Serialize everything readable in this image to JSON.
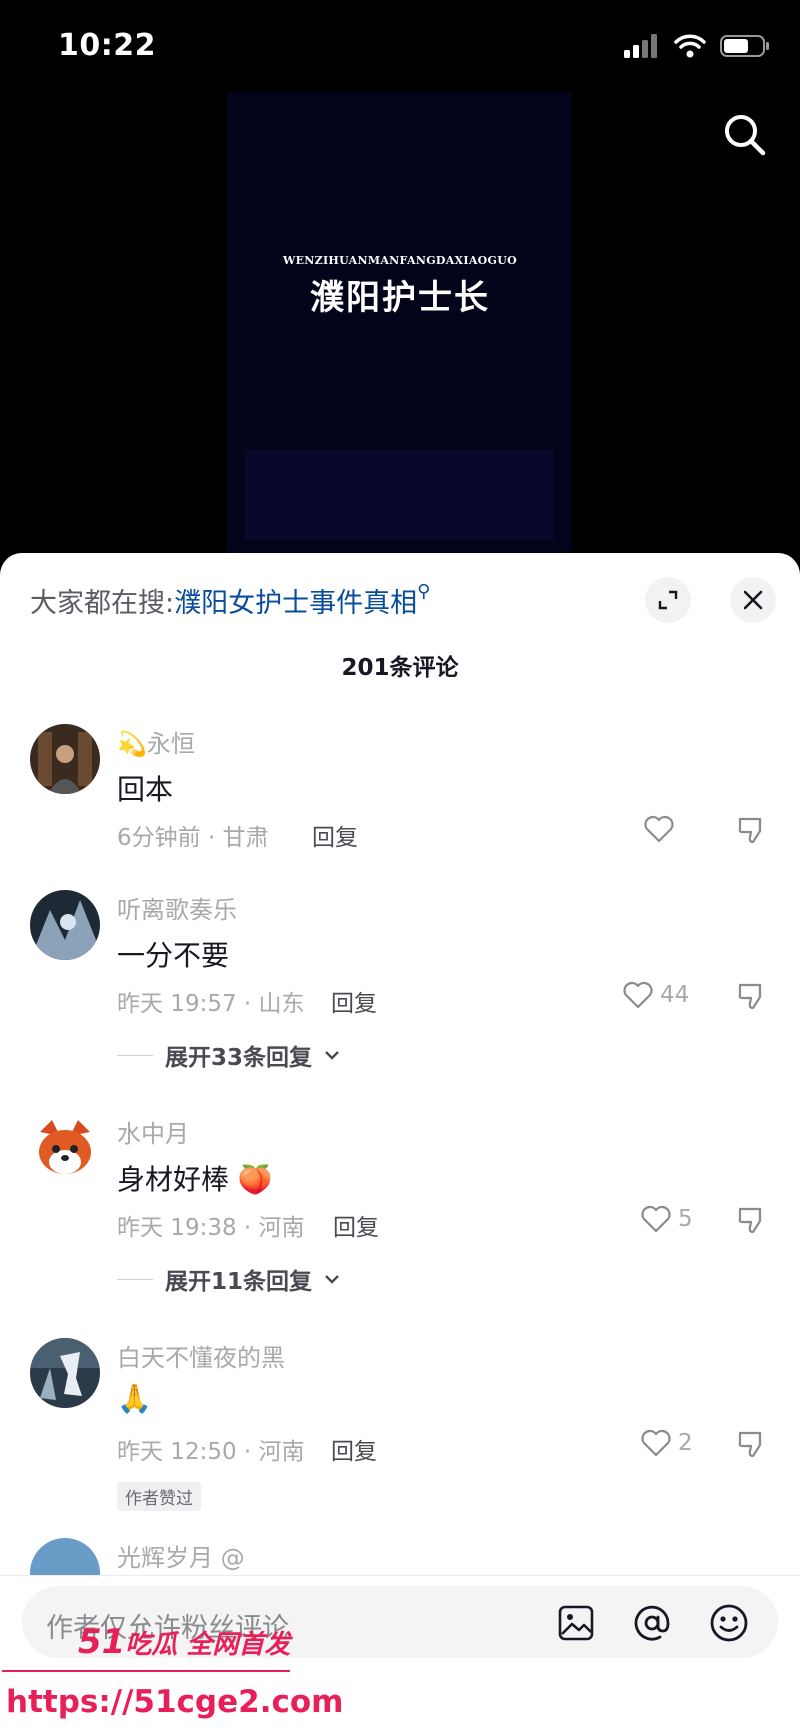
{
  "status_bar": {
    "time": "10:22"
  },
  "video": {
    "subtitle": "WENZIHUANMANFANGDAXIAOGUO",
    "title": "濮阳护士长"
  },
  "sheet": {
    "trending_prefix": "大家都在搜:",
    "trending_query": "濮阳女护士事件真相",
    "comment_count": "201条评论"
  },
  "comments": [
    {
      "username": "💫永恒",
      "text": "回本",
      "meta": "6分钟前 · 甘肃",
      "reply": "回复",
      "likes": ""
    },
    {
      "username": "听离歌奏乐",
      "text": "一分不要",
      "meta": "昨天 19:57 · 山东",
      "reply": "回复",
      "likes": "44",
      "expand": "展开33条回复"
    },
    {
      "username": "水中月",
      "text": "身材好棒 🍑",
      "meta": "昨天 19:38 · 河南",
      "reply": "回复",
      "likes": "5",
      "expand": "展开11条回复"
    },
    {
      "username": "白天不懂夜的黑",
      "text": "🙏",
      "meta": "昨天 12:50 · 河南",
      "reply": "回复",
      "likes": "2",
      "badge": "作者赞过"
    },
    {
      "username": "光辉岁月 @"
    }
  ],
  "input_bar": {
    "placeholder": "作者仅允许粉丝评论"
  },
  "watermark": {
    "brand_num": "51",
    "brand_text": "吃瓜 全网首发",
    "url": "https://51cge2.com"
  },
  "colors": {
    "link": "#0a4c9b",
    "watermark": "#e8205a",
    "muted": "#a8a9ad"
  }
}
